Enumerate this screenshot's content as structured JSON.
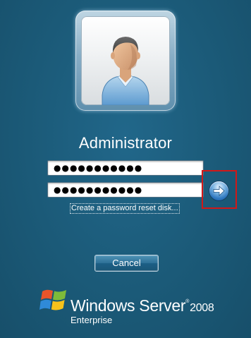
{
  "user": {
    "name": "Administrator",
    "avatar_icon": "user-avatar-icon"
  },
  "fields": {
    "field1_value": "●●●●●●●●●●●",
    "field2_value": "●●●●●●●●●●●"
  },
  "actions": {
    "submit_icon": "arrow-right-icon",
    "reset_link_label": "Create a password reset disk...",
    "cancel_label": "Cancel"
  },
  "branding": {
    "brand": "Windows Server",
    "registered_mark": "®",
    "version": "2008",
    "edition": "Enterprise",
    "logo_icon": "windows-flag-icon"
  },
  "colors": {
    "background": "#1b5a78",
    "highlight_box": "#d01818",
    "text": "#ffffff"
  }
}
